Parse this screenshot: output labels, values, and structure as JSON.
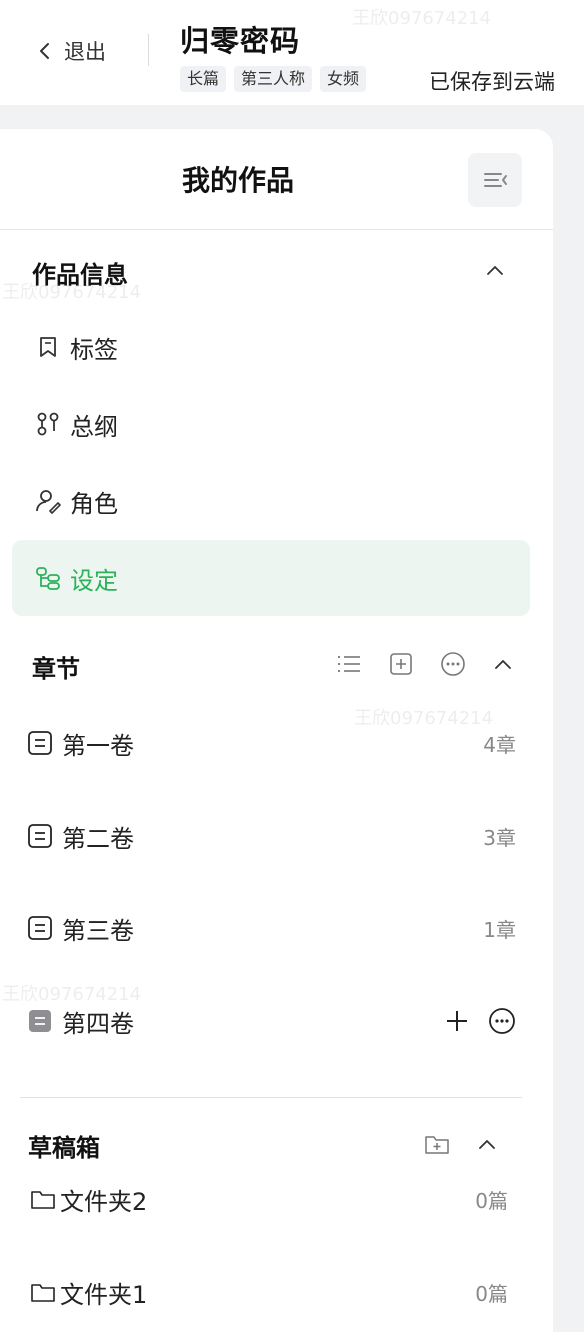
{
  "header": {
    "back_label": "退出",
    "book_title": "归零密码",
    "tags": [
      "长篇",
      "第三人称",
      "女频"
    ],
    "save_status": "已保存到云端"
  },
  "panel": {
    "title": "我的作品",
    "work_info": {
      "title": "作品信息",
      "items": [
        {
          "label": "标签",
          "icon": "bookmark-icon"
        },
        {
          "label": "总纲",
          "icon": "outline-icon"
        },
        {
          "label": "角色",
          "icon": "user-edit-icon"
        },
        {
          "label": "设定",
          "icon": "settings-tree-icon",
          "active": true
        }
      ]
    },
    "chapters": {
      "title": "章节",
      "volumes": [
        {
          "name": "第一卷",
          "count": "4章"
        },
        {
          "name": "第二卷",
          "count": "3章"
        },
        {
          "name": "第三卷",
          "count": "1章"
        },
        {
          "name": "第四卷",
          "count": "",
          "hovered": true
        }
      ]
    },
    "drafts": {
      "title": "草稿箱",
      "folders": [
        {
          "name": "文件夹2",
          "count": "0篇"
        },
        {
          "name": "文件夹1",
          "count": "0篇"
        }
      ]
    }
  },
  "watermark_text": "王欣097674214",
  "colors": {
    "accent_green": "#2bb25b",
    "active_bg": "#ecf5ef"
  }
}
